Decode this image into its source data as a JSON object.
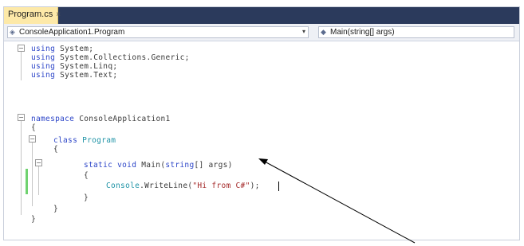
{
  "tab": {
    "label": "Program.cs",
    "close": "×"
  },
  "nav": {
    "left_dropdown": "ConsoleApplication1.Program",
    "right_dropdown": "Main(string[] args)"
  },
  "code": {
    "l1_kw": "using",
    "l1_rest": " System;",
    "l2_kw": "using",
    "l2_rest": " System.Collections.Generic;",
    "l3_kw": "using",
    "l3_rest": " System.Linq;",
    "l4_kw": "using",
    "l4_rest": " System.Text;",
    "l5_kw": "namespace",
    "l5_rest": " ConsoleApplication1",
    "l6": "{",
    "l7_kw": "class",
    "l7_type": " Program",
    "l8": "{",
    "l9_kw1": "static",
    "l9_kw2": " void",
    "l9_name": " Main(",
    "l9_kw3": "string",
    "l9_rest": "[] args)",
    "l10": "{",
    "l11_type": "Console",
    "l11_call": ".WriteLine(",
    "l11_str": "\"Hi from C#\"",
    "l11_end": ");",
    "l12": "}",
    "l13": "}",
    "l14": "}"
  },
  "colors": {
    "keyword": "#2c45c8",
    "type": "#1f93a6",
    "string": "#a52a2a",
    "changed_bar": "#6fd26f",
    "tab_active": "#fde9a8",
    "tabstrip": "#2b3a5c"
  }
}
